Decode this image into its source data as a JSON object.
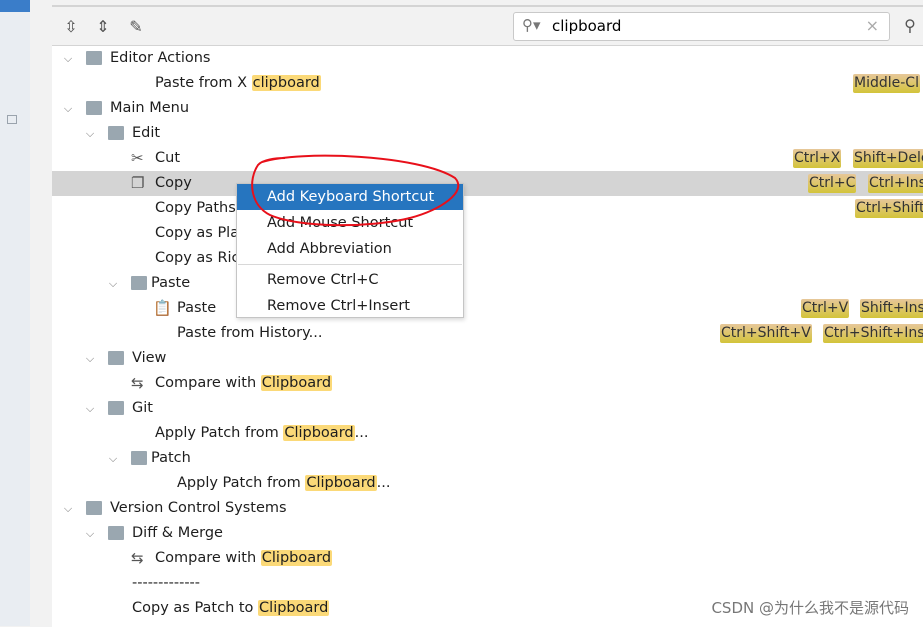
{
  "search": {
    "value": "clipboard",
    "placeholder": ""
  },
  "toolbar": {
    "expand_all": "expand-all-icon",
    "collapse_all": "collapse-all-icon",
    "edit": "edit-icon"
  },
  "tree": [
    {
      "label": "Editor Actions",
      "level": 0,
      "expanded": true,
      "icon": "editor-actions-folder-icon"
    },
    {
      "pre": "Paste from X ",
      "match": "clipboard",
      "post": "",
      "level": 2,
      "shortcuts": [
        "Middle-Cl"
      ]
    },
    {
      "label": "Main Menu",
      "level": 0,
      "expanded": true,
      "icon": "main-menu-folder-icon"
    },
    {
      "label": "Edit",
      "level": 1,
      "expanded": true,
      "icon": "folder-icon"
    },
    {
      "label": "Cut",
      "level": 2,
      "icon": "scissors-icon",
      "shortcuts": [
        "Ctrl+X",
        "Shift+Dele"
      ]
    },
    {
      "label": "Copy",
      "level": 2,
      "icon": "copy-icon",
      "selected": true,
      "shortcuts": [
        "Ctrl+C",
        "Ctrl+Ins"
      ]
    },
    {
      "label": "Copy Paths",
      "level": 2,
      "shortcuts": [
        "Ctrl+Shift"
      ]
    },
    {
      "label": "Copy as Pla",
      "level": 2
    },
    {
      "label": "Copy as Ric",
      "level": 2
    },
    {
      "label": "Paste",
      "level": 2,
      "expanded": true,
      "icon": "folder-icon",
      "folder": true
    },
    {
      "label": "Paste",
      "level": 3,
      "icon": "clipboard-icon",
      "shortcuts": [
        "Ctrl+V",
        "Shift+Ins"
      ]
    },
    {
      "label": "Paste from History...",
      "level": 3,
      "shortcuts": [
        "Ctrl+Shift+V",
        "Ctrl+Shift+Ins"
      ]
    },
    {
      "label": "View",
      "level": 1,
      "expanded": true,
      "icon": "folder-icon"
    },
    {
      "pre": "Compare with ",
      "match": "Clipboard",
      "post": "",
      "level": 2,
      "icon": "compare-icon"
    },
    {
      "label": "Git",
      "level": 1,
      "expanded": true,
      "icon": "folder-icon"
    },
    {
      "pre": "Apply Patch from ",
      "match": "Clipboard",
      "post": "...",
      "level": 2
    },
    {
      "label": "Patch",
      "level": 2,
      "expanded": true,
      "icon": "folder-icon",
      "folder": true
    },
    {
      "pre": "Apply Patch from ",
      "match": "Clipboard",
      "post": "...",
      "level": 3
    },
    {
      "label": "Version Control Systems",
      "level": 0,
      "expanded": true,
      "icon": "folder-icon"
    },
    {
      "label": "Diff & Merge",
      "level": 1,
      "expanded": true,
      "icon": "folder-icon"
    },
    {
      "pre": "Compare with ",
      "match": "Clipboard",
      "post": "",
      "level": 2,
      "icon": "compare-icon"
    },
    {
      "label": "-------------",
      "level": 1.1
    },
    {
      "pre": "Copy as Patch to ",
      "match": "Clipboard",
      "post": "",
      "level": 1.1
    }
  ],
  "context_menu": {
    "items": [
      "Add Keyboard Shortcut",
      "Add Mouse Shortcut",
      "Add Abbreviation",
      "Remove Ctrl+C",
      "Remove Ctrl+Insert"
    ],
    "active": "Add Keyboard Shortcut"
  },
  "colors": {
    "selection": "#2675bf",
    "highlight": "#fbd978",
    "annotation": "#e8101a"
  },
  "watermark": "CSDN @为什么我不是源代码"
}
